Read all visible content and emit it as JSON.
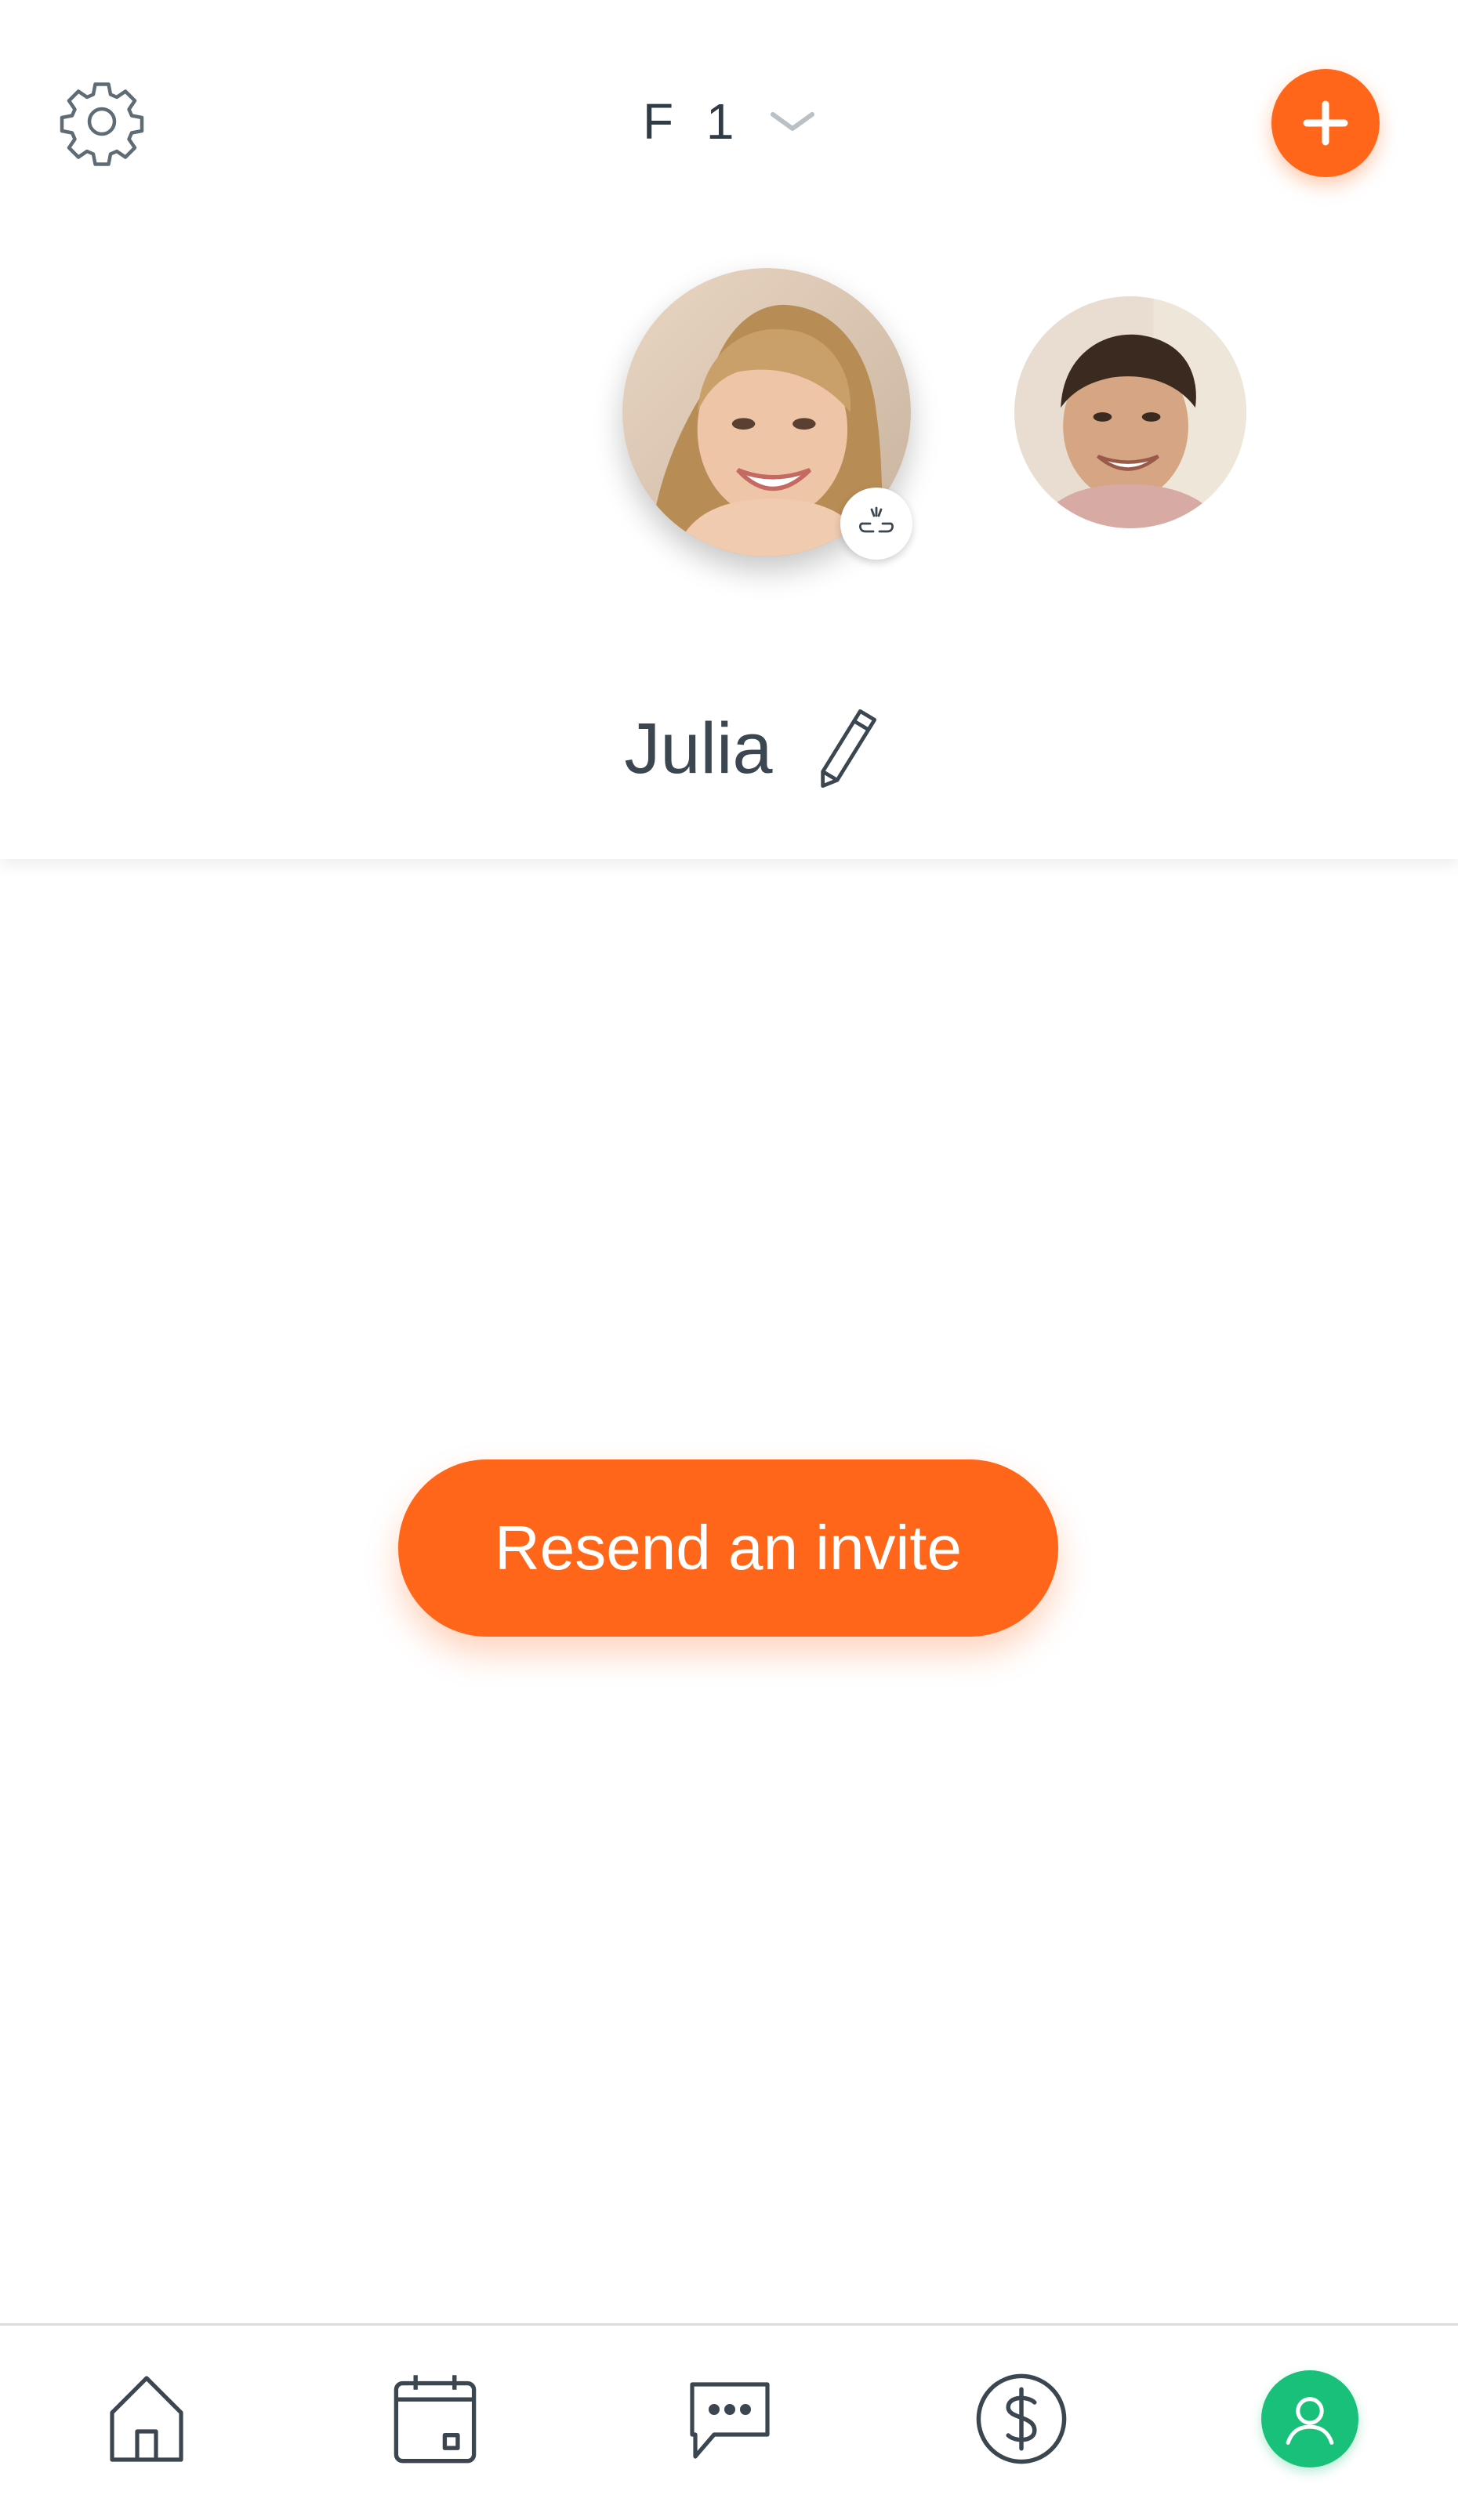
{
  "header": {
    "settings_icon": "gear-icon",
    "family_name": "F 1",
    "family_dropdown_icon": "chevron-down-icon",
    "add_icon": "plus-icon",
    "add_color": "#ff661a"
  },
  "profile": {
    "name": "Julia",
    "edit_icon": "pencil-icon",
    "link_status_icon": "broken-link-icon"
  },
  "actions": {
    "resend_label": "Resend an invite",
    "resend_color": "#ff661a"
  },
  "tabbar": {
    "items": [
      {
        "icon": "home-icon"
      },
      {
        "icon": "calendar-icon"
      },
      {
        "icon": "chat-icon"
      },
      {
        "icon": "dollar-icon"
      },
      {
        "icon": "profile-icon",
        "active": true,
        "active_color": "#18c07a"
      }
    ]
  }
}
